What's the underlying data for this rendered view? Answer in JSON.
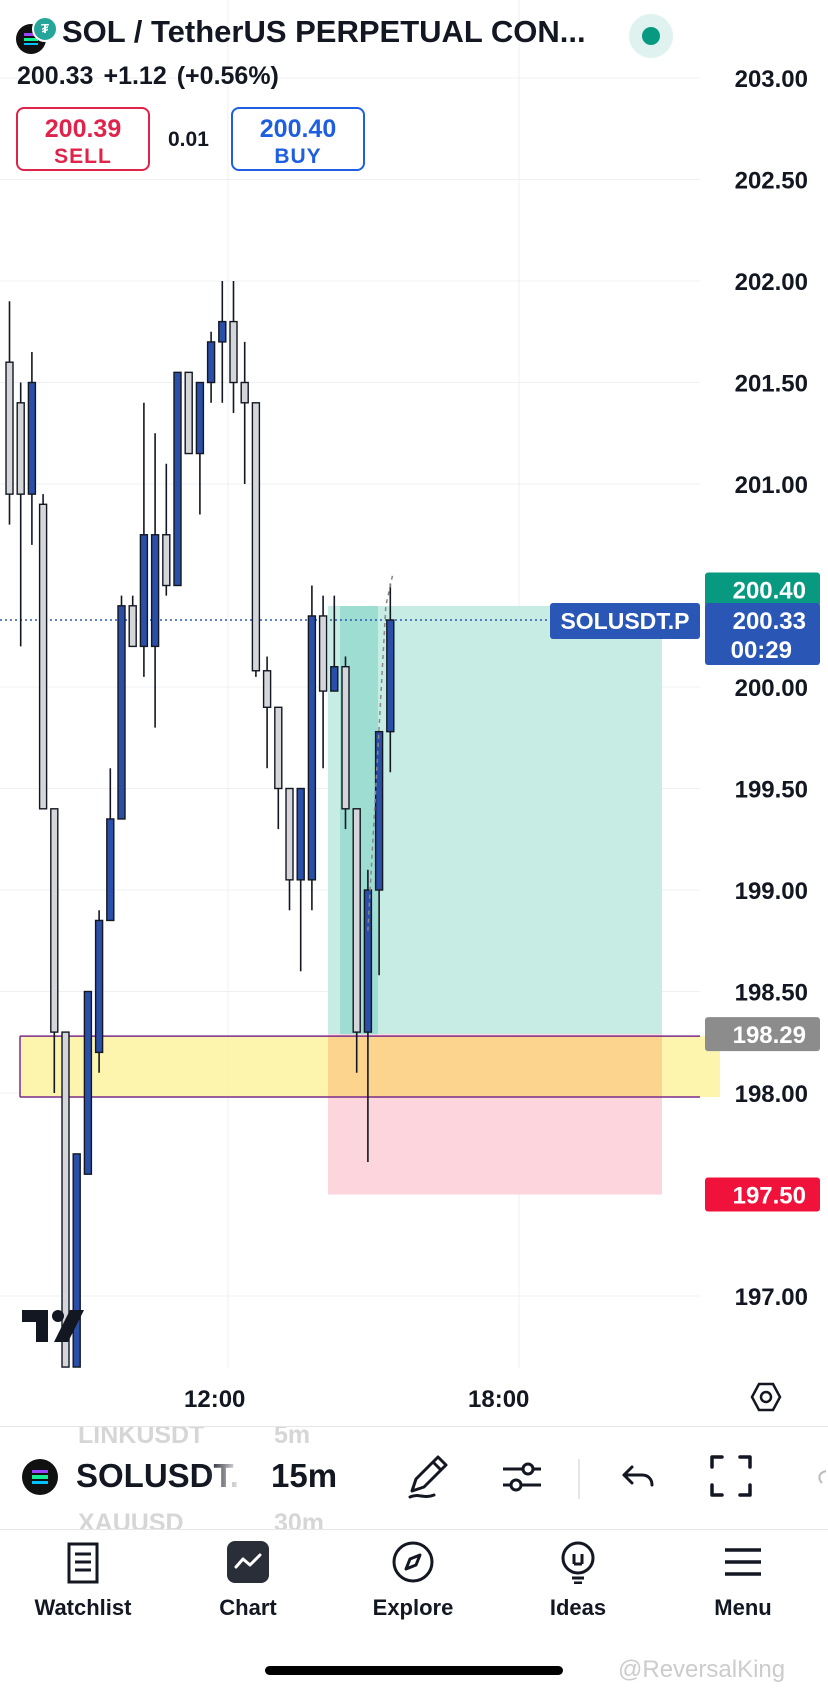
{
  "header": {
    "title": "SOL / TetherUS PERPETUAL CON...",
    "badge_glyph": "₮",
    "last_price": "200.33",
    "change": "+1.12",
    "change_pct": "(+0.56%)",
    "sell_price": "200.39",
    "sell_label": "SELL",
    "buy_price": "200.40",
    "buy_label": "BUY",
    "quantity": "0.01",
    "live_indicator_icon": "live-status-dot-icon"
  },
  "colors": {
    "bull": "#2a4fa8",
    "bear": "#d4d6da",
    "profit_zone": "#c6ece4",
    "loss_zone": "#fdd5dc",
    "zone_yellow": "#fdf3a0",
    "zone_orange": "#fdd08a",
    "zone_border": "#7b2c8a",
    "ask_tag": "#089981",
    "price_tag": "#2a57b5",
    "entry_tag": "#8c8c8c",
    "stop_tag": "#f0123a"
  },
  "chart_data": {
    "type": "candlestick",
    "symbol": "SOLUSDT.P",
    "interval": "15m",
    "y_ticks": [
      "203.00",
      "202.50",
      "202.00",
      "201.50",
      "201.00",
      "200.00",
      "199.50",
      "199.00",
      "198.50",
      "198.00",
      "197.00"
    ],
    "ylim": [
      196.7,
      203.2
    ],
    "x_ticks": [
      {
        "label": "12:00",
        "index": 19.5
      },
      {
        "label": "18:00",
        "index": 45.5
      }
    ],
    "candles": [
      [
        201.6,
        201.9,
        200.8,
        200.95
      ],
      [
        201.4,
        201.5,
        200.2,
        200.95
      ],
      [
        200.95,
        201.65,
        200.7,
        201.5
      ],
      [
        200.9,
        200.95,
        199.4,
        199.4
      ],
      [
        199.4,
        199.4,
        198.0,
        198.3
      ],
      [
        198.3,
        198.3,
        196.65,
        196.65
      ],
      [
        196.65,
        197.7,
        196.65,
        197.7
      ],
      [
        197.6,
        198.5,
        197.6,
        198.5
      ],
      [
        198.2,
        198.9,
        198.1,
        198.85
      ],
      [
        198.85,
        199.6,
        198.85,
        199.35
      ],
      [
        199.35,
        200.45,
        199.35,
        200.4
      ],
      [
        200.4,
        200.45,
        200.2,
        200.2
      ],
      [
        200.2,
        201.4,
        200.05,
        200.75
      ],
      [
        200.2,
        201.25,
        199.8,
        200.75
      ],
      [
        200.75,
        201.1,
        200.45,
        200.5
      ],
      [
        200.5,
        201.55,
        200.5,
        201.55
      ],
      [
        201.55,
        201.55,
        201.15,
        201.15
      ],
      [
        201.15,
        201.5,
        200.85,
        201.5
      ],
      [
        201.5,
        201.75,
        201.4,
        201.7
      ],
      [
        201.7,
        202.0,
        201.4,
        201.8
      ],
      [
        201.8,
        202.0,
        201.35,
        201.5
      ],
      [
        201.5,
        201.7,
        201.0,
        201.4
      ],
      [
        201.4,
        201.4,
        200.05,
        200.08
      ],
      [
        200.08,
        200.15,
        199.6,
        199.9
      ],
      [
        199.9,
        199.9,
        199.3,
        199.5
      ],
      [
        199.5,
        199.5,
        198.9,
        199.05
      ],
      [
        199.05,
        199.5,
        198.6,
        199.5
      ],
      [
        199.05,
        200.5,
        198.9,
        200.35
      ],
      [
        200.35,
        200.45,
        199.6,
        199.98
      ],
      [
        199.98,
        200.45,
        199.98,
        200.1
      ],
      [
        200.1,
        200.15,
        199.3,
        199.4
      ],
      [
        199.4,
        199.4,
        198.1,
        198.3
      ],
      [
        198.3,
        199.1,
        197.66,
        199.0
      ],
      [
        199.0,
        199.7,
        198.58,
        199.78
      ],
      [
        199.78,
        200.51,
        199.58,
        200.33
      ]
    ],
    "levels": {
      "ask": "200.40",
      "last": "200.33",
      "entry": "198.29",
      "stop": "197.50",
      "countdown": "00:29"
    },
    "position": {
      "side": "long",
      "entry": 198.29,
      "target": 200.33,
      "stop": 197.5,
      "label": "SOLUSDT.P"
    },
    "zone": {
      "top": 198.28,
      "bottom": 197.98
    }
  },
  "toolbar": {
    "symbol": "SOLUSDT.P",
    "interval": "15m",
    "ghost_above_symbol": "LINKUSDT",
    "ghost_above_interval": "5m",
    "ghost_below_symbol": "XAUUSD",
    "ghost_below_interval": "30m"
  },
  "nav": {
    "items": [
      {
        "label": "Watchlist",
        "icon": "watchlist-icon"
      },
      {
        "label": "Chart",
        "icon": "chart-icon"
      },
      {
        "label": "Explore",
        "icon": "compass-icon"
      },
      {
        "label": "Ideas",
        "icon": "lightbulb-icon"
      },
      {
        "label": "Menu",
        "icon": "hamburger-icon"
      }
    ]
  },
  "watermark": "@ReversalKing"
}
